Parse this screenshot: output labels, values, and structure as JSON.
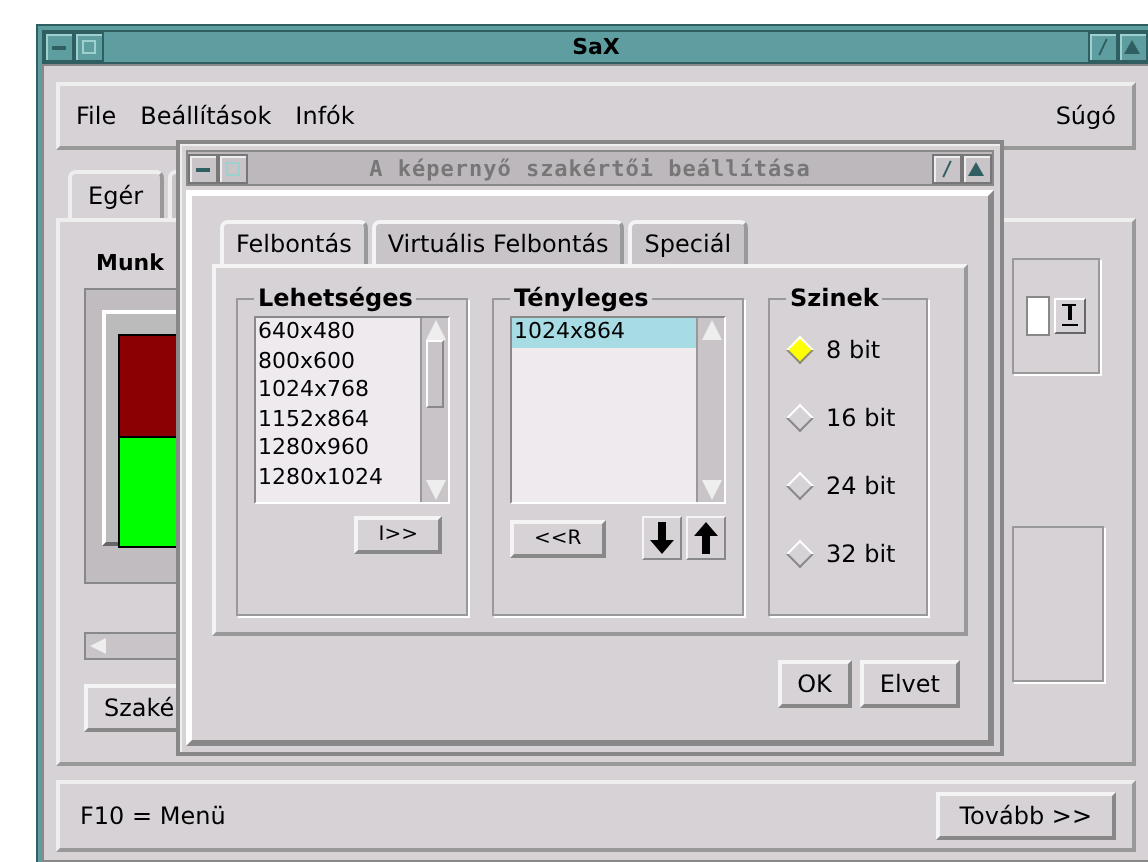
{
  "window": {
    "title": "SaX"
  },
  "menu": {
    "items": [
      "File",
      "Beállítások",
      "Infók"
    ],
    "help": "Súgó"
  },
  "tabs": [
    {
      "label": "Egér",
      "selected": true
    }
  ],
  "main_panel": {
    "heading": "Munk",
    "button": "Szaké"
  },
  "status_bar": {
    "text": "F10 = Menü",
    "next_button": "Tovább >>"
  },
  "dialog": {
    "title": "A képernyő szakértői beállítása",
    "tabs": [
      {
        "label": "Felbontás",
        "selected": true
      },
      {
        "label": "Virtuális Felbontás",
        "selected": false
      },
      {
        "label": "Speciál",
        "selected": false
      }
    ],
    "available": {
      "title": "Lehetséges",
      "items": [
        {
          "label": "640x480",
          "selected": false
        },
        {
          "label": "800x600",
          "selected": false
        },
        {
          "label": "1024x768",
          "selected": false
        },
        {
          "label": "1152x864",
          "selected": false
        },
        {
          "label": "1280x960",
          "selected": false
        },
        {
          "label": "1280x1024",
          "selected": false
        }
      ],
      "add_button": "I>>"
    },
    "actual": {
      "title": "Tényleges",
      "items": [
        {
          "label": "1024x864",
          "selected": true
        }
      ],
      "remove_button": "<<R"
    },
    "colors": {
      "title": "Szinek",
      "options": [
        {
          "label": "8 bit",
          "selected": true
        },
        {
          "label": "16 bit",
          "selected": false
        },
        {
          "label": "24 bit",
          "selected": false
        },
        {
          "label": "32 bit",
          "selected": false
        }
      ]
    },
    "buttons": [
      "OK",
      "Elvet"
    ]
  }
}
